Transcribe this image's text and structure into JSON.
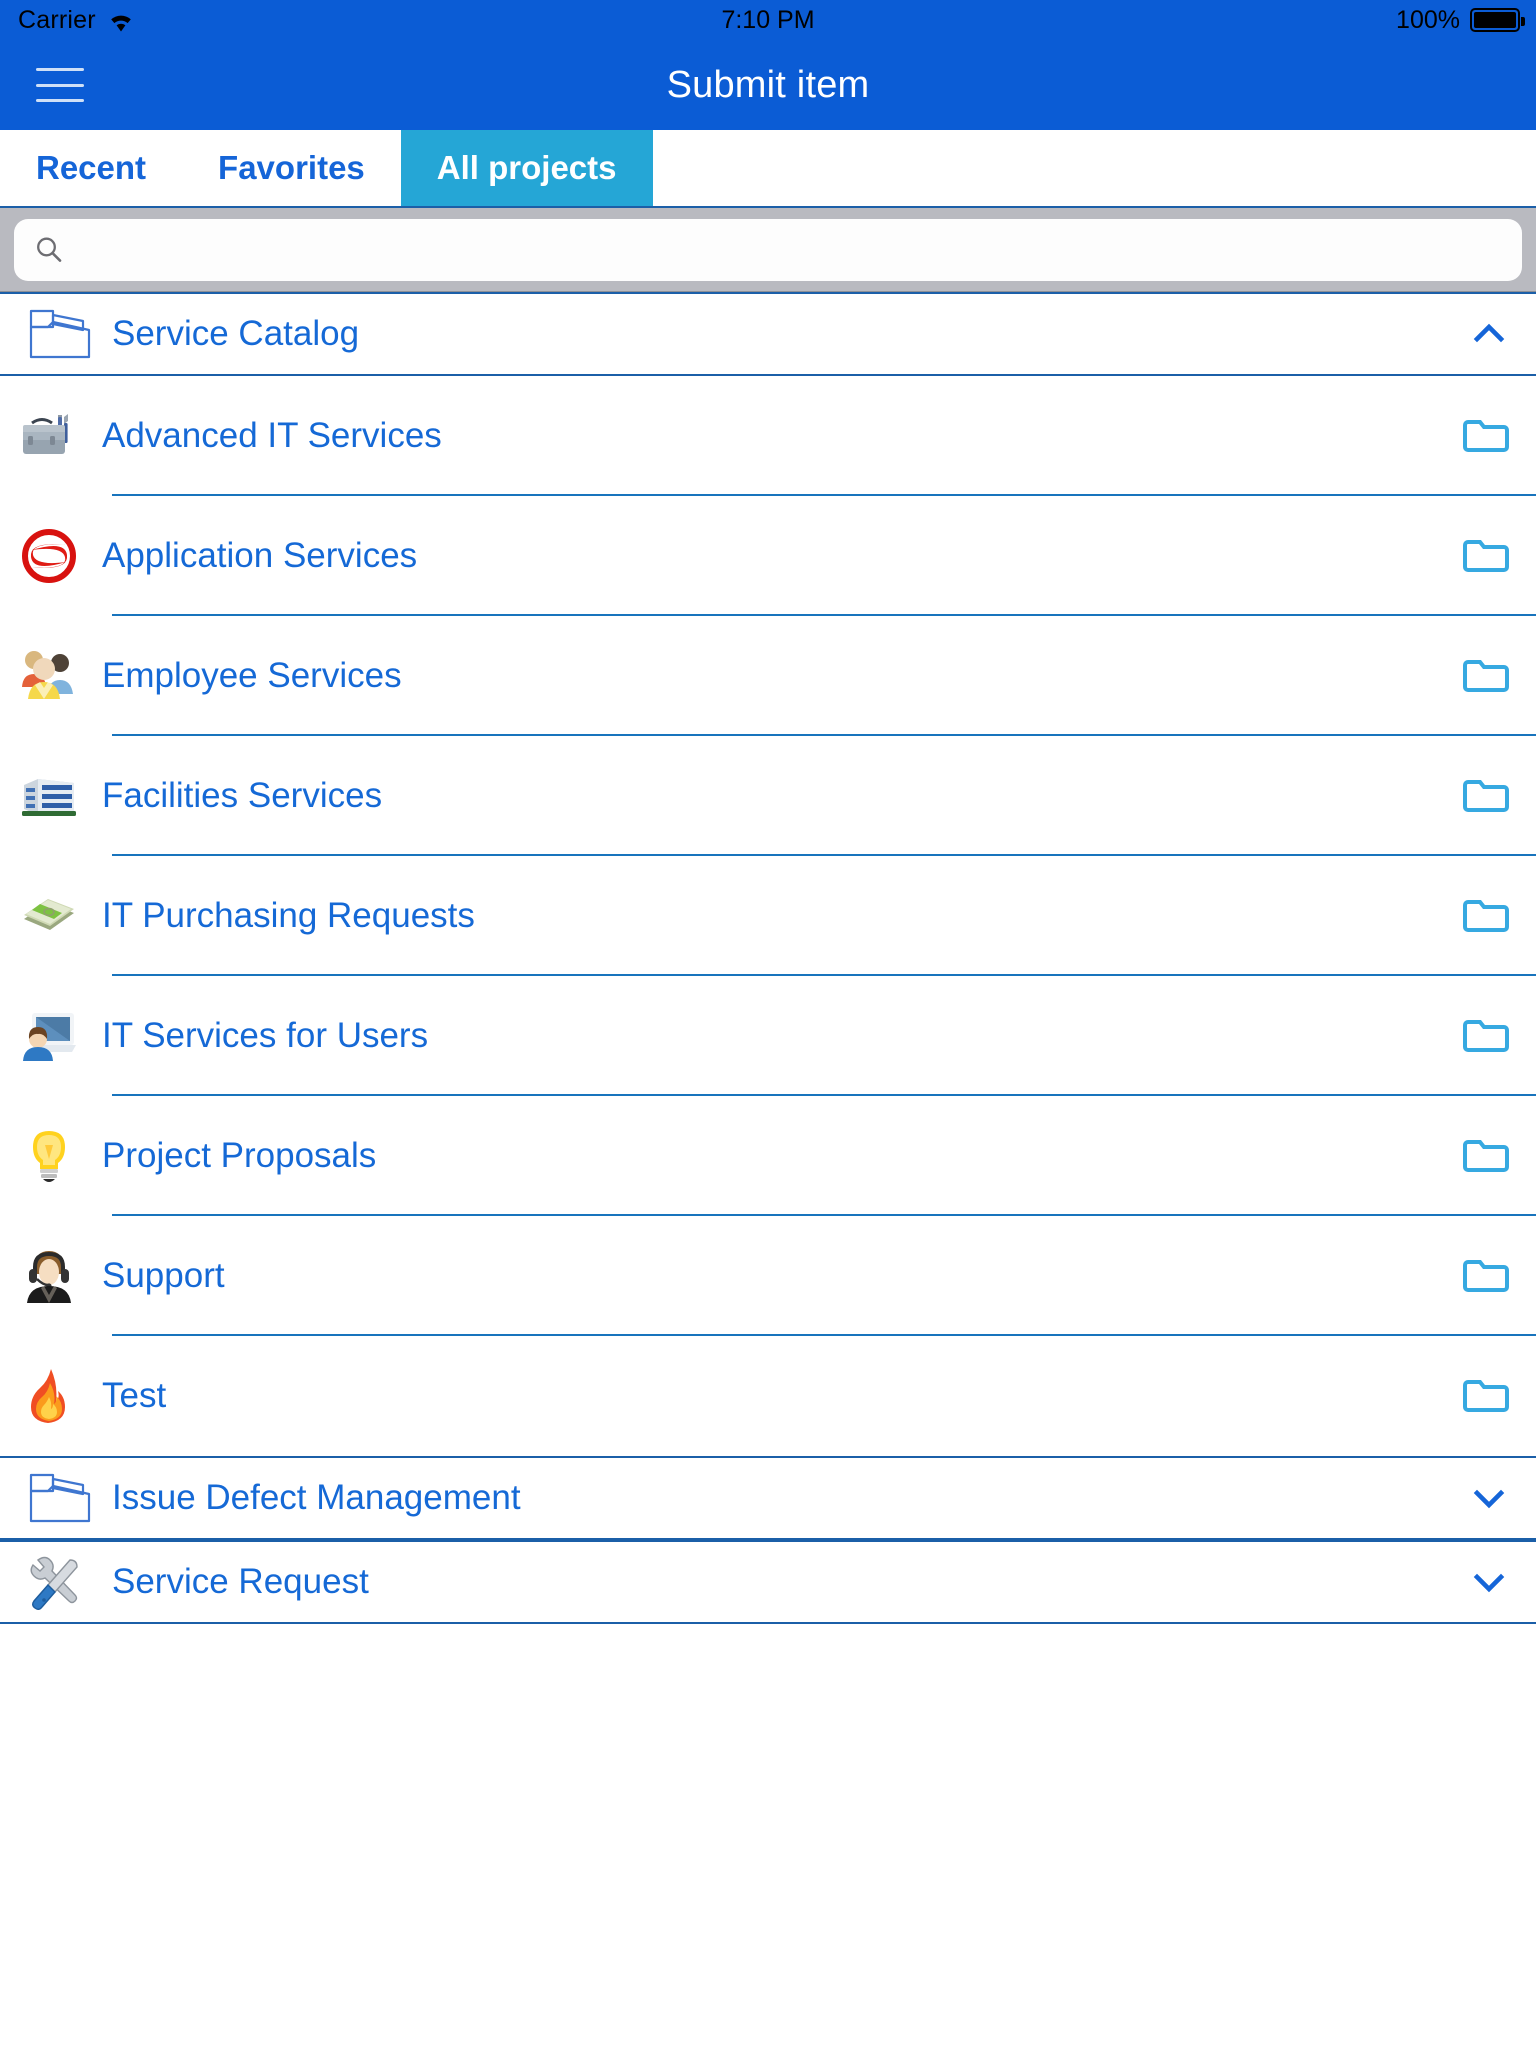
{
  "status_bar": {
    "carrier": "Carrier",
    "wifi_icon": "wifi-icon",
    "time": "7:10 PM",
    "battery_percent": "100%",
    "battery_icon": "battery-full-icon"
  },
  "nav_bar": {
    "menu_icon": "hamburger-menu-icon",
    "title": "Submit item"
  },
  "tabs": [
    {
      "label": "Recent",
      "active": false
    },
    {
      "label": "Favorites",
      "active": false
    },
    {
      "label": "All projects",
      "active": true
    }
  ],
  "search": {
    "icon": "search-icon",
    "value": "",
    "placeholder": ""
  },
  "groups": [
    {
      "label": "Service Catalog",
      "icon": "open-folder-outline-icon",
      "expanded": true,
      "chevron": "chevron-up-icon",
      "items": [
        {
          "label": "Advanced IT Services",
          "icon": "toolbox-icon",
          "trailing_icon": "folder-icon"
        },
        {
          "label": "Application Services",
          "icon": "red-swirl-logo-icon",
          "trailing_icon": "folder-icon"
        },
        {
          "label": "Employee Services",
          "icon": "people-group-icon",
          "trailing_icon": "folder-icon"
        },
        {
          "label": "Facilities Services",
          "icon": "office-building-icon",
          "trailing_icon": "folder-icon"
        },
        {
          "label": "IT Purchasing Requests",
          "icon": "money-stack-icon",
          "trailing_icon": "folder-icon"
        },
        {
          "label": "IT Services for Users",
          "icon": "computer-user-icon",
          "trailing_icon": "folder-icon"
        },
        {
          "label": "Project Proposals",
          "icon": "lightbulb-icon",
          "trailing_icon": "folder-icon"
        },
        {
          "label": "Support",
          "icon": "headset-agent-icon",
          "trailing_icon": "folder-icon"
        },
        {
          "label": "Test",
          "icon": "flame-icon",
          "trailing_icon": "folder-icon"
        }
      ]
    },
    {
      "label": "Issue Defect Management",
      "icon": "open-folder-outline-icon",
      "expanded": false,
      "chevron": "chevron-down-icon",
      "items": []
    },
    {
      "label": "Service Request",
      "icon": "wrench-screwdriver-icon",
      "expanded": false,
      "chevron": "chevron-down-icon",
      "items": []
    }
  ],
  "colors": {
    "nav_blue": "#0B5CD5",
    "tab_active": "#25A6D6",
    "link_blue": "#1569d6",
    "search_bar_gray": "#b9bac0",
    "separator_blue": "#1874bd"
  }
}
